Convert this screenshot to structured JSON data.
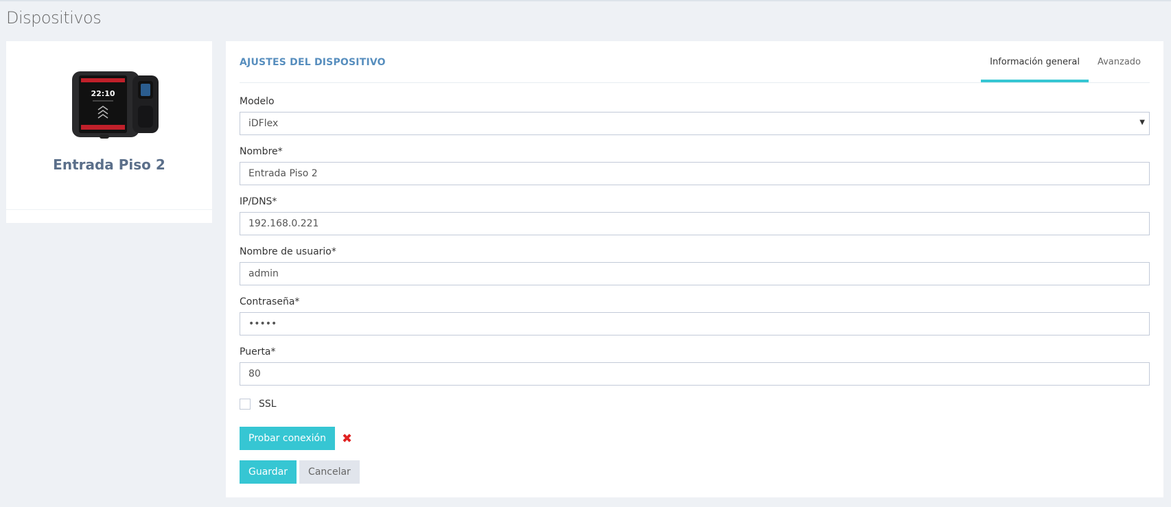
{
  "page": {
    "title": "Dispositivos"
  },
  "device": {
    "name": "Entrada Piso 2",
    "image": {
      "icon": "fingerprint-terminal-icon",
      "screen_time": "22:10"
    }
  },
  "settings": {
    "title": "AJUSTES DEL DISPOSITIVO",
    "tabs": [
      {
        "label": "Información general",
        "active": true
      },
      {
        "label": "Avanzado",
        "active": false
      }
    ],
    "fields": {
      "modelo": {
        "label": "Modelo",
        "value": "iDFlex"
      },
      "nombre": {
        "label": "Nombre*",
        "value": "Entrada Piso 2"
      },
      "ip": {
        "label": "IP/DNS*",
        "value": "192.168.0.221"
      },
      "usuario": {
        "label": "Nombre de usuario*",
        "value": "admin"
      },
      "contrasena": {
        "label": "Contraseña*",
        "value": "•••••"
      },
      "puerta": {
        "label": "Puerta*",
        "value": "80"
      }
    },
    "ssl": {
      "label": "SSL",
      "checked": false
    },
    "test_button": "Probar conexión",
    "test_status_icon": "x-mark-icon",
    "save_button": "Guardar",
    "cancel_button": "Cancelar"
  },
  "colors": {
    "accent": "#36c6d3",
    "title_blue": "#578ebe",
    "error": "#e02222",
    "background": "#eef1f5"
  }
}
